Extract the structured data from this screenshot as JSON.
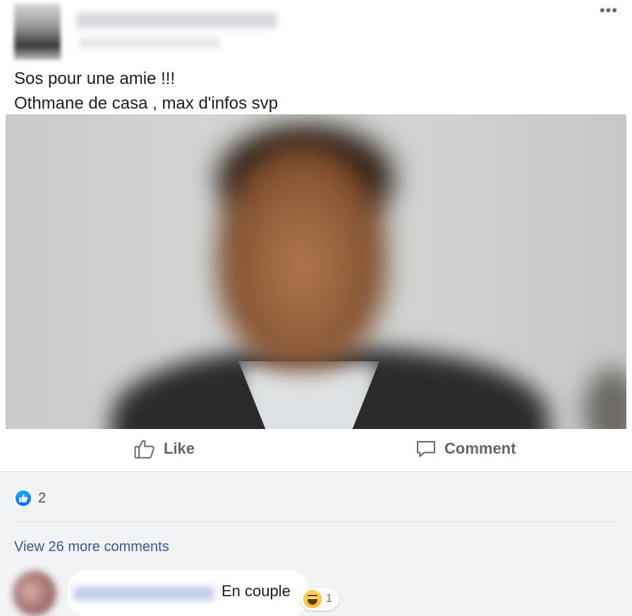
{
  "post": {
    "menu_icon": "more-horizontal-icon",
    "text_lines": [
      "Sos pour une amie !!!",
      "Othmane de casa , max d'infos svp"
    ]
  },
  "actions": {
    "like_label": "Like",
    "like_icon": "thumbs-up-icon",
    "comment_label": "Comment",
    "comment_icon": "speech-bubble-icon"
  },
  "reactions": {
    "icon": "like-reaction-icon",
    "count": "2"
  },
  "comments": {
    "view_more": "View 26 more comments",
    "items": [
      {
        "text": "En couple",
        "reaction_icon": "haha-reaction-icon",
        "reaction_count": "1"
      }
    ]
  },
  "colors": {
    "link": "#385898",
    "like_blue": "#0866ff",
    "action_grey": "#606770",
    "panel_bg": "#f2f3f5"
  }
}
